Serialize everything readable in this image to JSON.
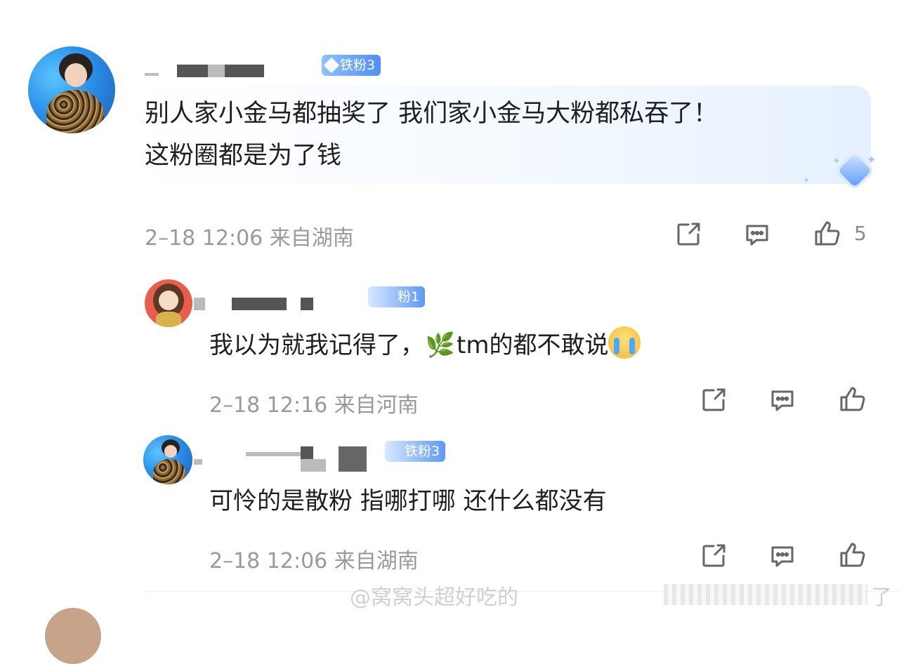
{
  "top_partial_text": "",
  "comments": [
    {
      "badge": "铁粉3",
      "text_line1": "别人家小金马都抽奖了 我们家小金马大粉都私吞了！",
      "text_line2": "这粉圈都是为了钱",
      "meta": "2–18 12:06 来自湖南",
      "likes": "5"
    },
    {
      "badge": "粉1",
      "text_before": "我以为就我记得了，",
      "leaf_emoji": "🌿",
      "text_after": "tm的都不敢说",
      "meta": "2–18 12:16 来自河南"
    },
    {
      "badge": "铁粉3",
      "text": "可怜的是散粉 指哪打哪 还什么都没有",
      "meta": "2–18 12:06 来自湖南"
    }
  ],
  "watermark": "@窝窝头超好吃的",
  "watermark_tail": "了",
  "icons": [
    "share-icon",
    "comment-icon",
    "like-icon"
  ],
  "colors": {
    "badge": "#4f8ff5",
    "meta": "#9a9a9a"
  }
}
